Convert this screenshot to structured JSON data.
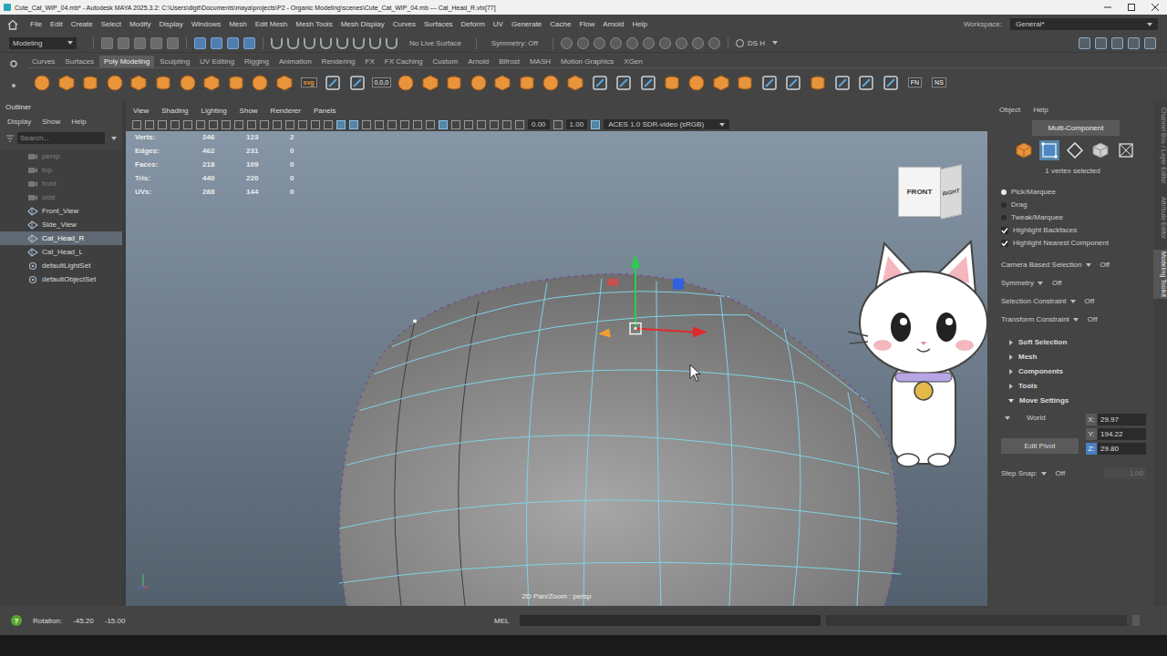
{
  "window": {
    "title": "Cute_Cat_WIP_04.mb* - Autodesk MAYA 2025.3.2: C:\\Users\\digit\\Documents\\maya\\projects\\P2 - Organic Modeling\\scenes\\Cute_Cat_WIP_04.mb  ---  Cat_Head_R.vtx[77]"
  },
  "menu_bar": {
    "items": [
      "File",
      "Edit",
      "Create",
      "Select",
      "Modify",
      "Display",
      "Windows",
      "Mesh",
      "Edit Mesh",
      "Mesh Tools",
      "Mesh Display",
      "Curves",
      "Surfaces",
      "Deform",
      "UV",
      "Generate",
      "Cache",
      "Flow",
      "Arnold",
      "Help"
    ],
    "workspace_label": "Workspace:",
    "workspace": "General*"
  },
  "status_line": {
    "mode": "Modeling",
    "live_surface": "No Live Surface",
    "symmetry": "Symmetry: Off",
    "user": "DS H"
  },
  "shelf": {
    "tabs": [
      {
        "label": "Curves",
        "selected": false
      },
      {
        "label": "Surfaces",
        "selected": false
      },
      {
        "label": "Poly Modeling",
        "selected": true
      },
      {
        "label": "Sculpting",
        "selected": false
      },
      {
        "label": "UV Editing",
        "selected": false
      },
      {
        "label": "Rigging",
        "selected": false
      },
      {
        "label": "Animation",
        "selected": false
      },
      {
        "label": "Rendering",
        "selected": false
      },
      {
        "label": "FX",
        "selected": false
      },
      {
        "label": "FX Caching",
        "selected": false
      },
      {
        "label": "Custom",
        "selected": false
      },
      {
        "label": "Arnold",
        "selected": false
      },
      {
        "label": "Bifrost",
        "selected": false
      },
      {
        "label": "MASH",
        "selected": false
      },
      {
        "label": "Motion Graphics",
        "selected": false
      },
      {
        "label": "XGen",
        "selected": false
      }
    ],
    "icons": [
      {
        "kind": "primitive"
      },
      {
        "kind": "primitive"
      },
      {
        "kind": "primitive"
      },
      {
        "kind": "primitive"
      },
      {
        "kind": "primitive"
      },
      {
        "kind": "primitive"
      },
      {
        "kind": "primitive"
      },
      {
        "kind": "primitive"
      },
      {
        "kind": "primitive"
      },
      {
        "kind": "primitive"
      },
      {
        "kind": "primitive"
      },
      {
        "kind": "text",
        "text": "svg"
      },
      {
        "kind": "tool"
      },
      {
        "kind": "tool"
      },
      {
        "kind": "text",
        "text": "0,0,0"
      },
      {
        "kind": "primitive"
      },
      {
        "kind": "primitive"
      },
      {
        "kind": "primitive"
      },
      {
        "kind": "primitive"
      },
      {
        "kind": "primitive"
      },
      {
        "kind": "primitive"
      },
      {
        "kind": "primitive"
      },
      {
        "kind": "primitive"
      },
      {
        "kind": "tool"
      },
      {
        "kind": "tool"
      },
      {
        "kind": "tool"
      },
      {
        "kind": "primitive"
      },
      {
        "kind": "primitive"
      },
      {
        "kind": "primitive"
      },
      {
        "kind": "primitive"
      },
      {
        "kind": "tool"
      },
      {
        "kind": "tool"
      },
      {
        "kind": "primitive"
      },
      {
        "kind": "tool"
      },
      {
        "kind": "tool"
      },
      {
        "kind": "tool"
      },
      {
        "kind": "text",
        "text": "FN"
      },
      {
        "kind": "text",
        "text": "NS"
      }
    ]
  },
  "outliner": {
    "title": "Outliner",
    "menu": [
      "Display",
      "Show",
      "Help"
    ],
    "search": {
      "placeholder": "Search..."
    },
    "items": [
      {
        "label": "persp",
        "kind": "camera",
        "dimmed": true,
        "selected": false
      },
      {
        "label": "top",
        "kind": "camera",
        "dimmed": true,
        "selected": false
      },
      {
        "label": "front",
        "kind": "camera",
        "dimmed": true,
        "selected": false
      },
      {
        "label": "side",
        "kind": "camera",
        "dimmed": true,
        "selected": false
      },
      {
        "label": "Front_View",
        "kind": "mesh",
        "dimmed": false,
        "selected": false
      },
      {
        "label": "Side_View",
        "kind": "mesh",
        "dimmed": false,
        "selected": false
      },
      {
        "label": "Cat_Head_R",
        "kind": "mesh",
        "dimmed": false,
        "selected": true
      },
      {
        "label": "Cat_Head_L",
        "kind": "mesh",
        "dimmed": false,
        "selected": false
      },
      {
        "label": "defaultLightSet",
        "kind": "set",
        "dimmed": false,
        "selected": false
      },
      {
        "label": "defaultObjectSet",
        "kind": "set",
        "dimmed": false,
        "selected": false
      }
    ]
  },
  "viewport": {
    "menu": [
      "View",
      "Shading",
      "Lighting",
      "Show",
      "Renderer",
      "Panels"
    ],
    "toolbar_values": [
      "0.00",
      "1.00"
    ],
    "color_space": "ACES 1.0 SDR-video (sRGB)",
    "hud": [
      {
        "label": "Verts:",
        "values": [
          "246",
          "123",
          "2"
        ]
      },
      {
        "label": "Edges:",
        "values": [
          "462",
          "231",
          "0"
        ]
      },
      {
        "label": "Faces:",
        "values": [
          "218",
          "109",
          "0"
        ]
      },
      {
        "label": "Tris:",
        "values": [
          "440",
          "220",
          "0"
        ]
      },
      {
        "label": "UVs:",
        "values": [
          "288",
          "144",
          "0"
        ]
      }
    ],
    "view_cube": {
      "front": "FRONT",
      "right": "RIGHT"
    },
    "camera_label": "2D Pan/Zoom : persp"
  },
  "toolkit": {
    "menu": [
      "Object",
      "Help"
    ],
    "mode_button": "Multi-Component",
    "component_modes": [
      {
        "kind": "object",
        "selected": false
      },
      {
        "kind": "multi",
        "selected": true
      },
      {
        "kind": "edge",
        "selected": false
      },
      {
        "kind": "face",
        "selected": false
      },
      {
        "kind": "uv",
        "selected": false
      }
    ],
    "selection_info": "1 vertex selected",
    "selection_modes": [
      {
        "label": "Pick/Marquee",
        "selected": true
      },
      {
        "label": "Drag",
        "selected": false
      },
      {
        "label": "Tweak/Marquee",
        "selected": false
      }
    ],
    "checkboxes": [
      {
        "label": "Highlight Backfaces",
        "checked": true
      },
      {
        "label": "Highlight Nearest Component",
        "checked": true
      }
    ],
    "options": [
      {
        "label": "Camera Based Selection",
        "value": "Off"
      },
      {
        "label": "Symmetry",
        "value": "Off"
      },
      {
        "label": "Selection Constraint",
        "value": "Off"
      },
      {
        "label": "Transform Constraint",
        "value": "Off"
      }
    ],
    "sections": [
      {
        "label": "Soft Selection",
        "expanded": false
      },
      {
        "label": "Mesh",
        "expanded": false
      },
      {
        "label": "Components",
        "expanded": false
      },
      {
        "label": "Tools",
        "expanded": false
      },
      {
        "label": "Move Settings",
        "expanded": true
      }
    ],
    "move_settings": {
      "space": "World",
      "coords": [
        {
          "axis": "X:",
          "value": "29.97",
          "selected": false
        },
        {
          "axis": "Y:",
          "value": "194.22",
          "selected": false
        },
        {
          "axis": "Z:",
          "value": "29.80",
          "selected": true
        }
      ],
      "edit_pivot": "Edit Pivot",
      "step_snap": {
        "label": "Step Snap:",
        "value": "Off",
        "amount": "1.00",
        "disabled": true
      }
    }
  },
  "side_tabs": [
    {
      "label": "Channel Box / Layer Editor",
      "selected": false
    },
    {
      "label": "Attribute Editor",
      "selected": false
    },
    {
      "label": "Modeling Toolkit",
      "selected": true
    }
  ],
  "help_line": {
    "icon": "?",
    "label": "Rotation:",
    "values": [
      "-45.20",
      "-15.00"
    ]
  },
  "command_line": {
    "language": "MEL"
  }
}
